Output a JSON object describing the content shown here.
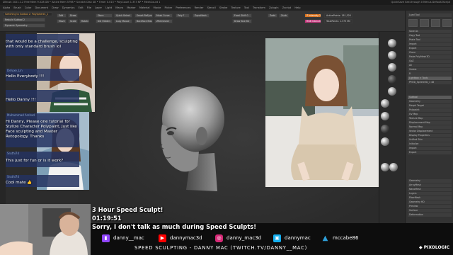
{
  "titlebar": {
    "text": "ZBrush 2021.1.2   Free Mem 9.028 GB • Active Mem 5798 • Scratch Disk 48 • Timer 0.013 • PolyCount 1.373 KP • MeshCount 1",
    "right": "QuickSave   See-through 0   Menus   DefaultZScript"
  },
  "menubar": {
    "items": [
      "Alpha",
      "Brush",
      "Color",
      "Document",
      "Draw",
      "Dynamics",
      "Edit",
      "File",
      "Layer",
      "Light",
      "Macro",
      "Marker",
      "Material",
      "Movie",
      "Picker",
      "Preferences",
      "Render",
      "Stencil",
      "Stroke",
      "Texture",
      "Tool",
      "Transform",
      "Zplugin",
      "Zscript",
      "Help"
    ]
  },
  "toolbar": {
    "switch_to": "Switching to Subtool 2: PolySphere1_1",
    "sub_left_1": "Rebuild Subtool 2",
    "sub_left_2": "Dynamic Symmetry",
    "edit": "Edit",
    "draw": "Draw",
    "move": "Move",
    "scale": "Scale",
    "rotate": "Rotate",
    "btn1": "Store",
    "btn2": "Quick Select",
    "btn3": "Smart ReSym",
    "btn4": "Mask Curve",
    "btn5": "Del Hidden",
    "btn6": "Lazy Mouse",
    "btn7": "Backface Mask",
    "btn8": "ZRemesher",
    "btn9": "Poly F",
    "dynamesh": "DynaMesh",
    "focal": "Focal Shift 0",
    "drawsize": "Draw Size 64",
    "zadd": "Zadd",
    "zsub": "Zsub",
    "zintensity": "Z Intensity 25",
    "rgbintensity": "RGB Intensity 100",
    "activepoints": "ActivePoints: 181,528",
    "totalpoints": "TotalPoints: 1.373 Mil"
  },
  "palette": {
    "rows": [
      "Load Tool",
      "Save As",
      "Copy Tool",
      "Paste Tool",
      "Import",
      "Export",
      "Clone",
      "Make PolyMesh3D",
      "GoZ",
      "All",
      "Visible",
      "R",
      "Lightbox > Tools",
      "PM3D_Sphere3D_1 48",
      "Subtool",
      "Geometry",
      "Morph Target",
      "Polypaint",
      "UV Map",
      "Texture Map",
      "Displacement Map",
      "Normal Map",
      "Vector Displacement",
      "Display Properties",
      "Unified Skin",
      "Initialize",
      "Import",
      "Export"
    ],
    "lower": [
      "Geometry",
      "ArrayMesh",
      "NanoMesh",
      "Layers",
      "FiberMesh",
      "Geometry HD",
      "Preview",
      "Surface",
      "Deformation"
    ]
  },
  "chat": {
    "messages": [
      {
        "name": "",
        "text": "that would be a challenge, sculpting with only standard brush lol"
      },
      {
        "name": "Deluxe_Lin",
        "text": "Hello Everybody !!!"
      },
      {
        "name": "",
        "text": "Hello Danny !!!"
      },
      {
        "name": "Muhammad Arshad",
        "text": "Hi Danny, Please one tutorial for Stylize Character Polypaint, Just like Face sculpting and Master Retopology. Thanks"
      },
      {
        "name": "Sruthi74",
        "text": "This just for fun or is it work?"
      },
      {
        "name": "Sruthi74",
        "text": "Cool mate 👍"
      }
    ]
  },
  "captions": {
    "title": "3 Hour Speed Sculpt!",
    "timer": "01:19:51",
    "note": "Sorry, I don't talk as much during Speed Sculpts!"
  },
  "socials": [
    {
      "platform": "twitch-icon",
      "handle": "danny__mac",
      "color": "#9146ff"
    },
    {
      "platform": "youtube-icon",
      "handle": "dannymac3d",
      "color": "#ff0000"
    },
    {
      "platform": "instagram-icon",
      "handle": "danny_mac3d",
      "color": "#d62976"
    },
    {
      "platform": "artstation-icon",
      "handle": "dannymac",
      "color": "#13aff0"
    },
    {
      "platform": "artstation-logo-icon",
      "handle": "mccabe86",
      "color": "#2e9fd8"
    }
  ],
  "footer": "SPEED SCULPTING - DANNY MAC (TWITCH.TV/DANNY__MAC)",
  "brand": "PIXOLOGIC",
  "colors": {
    "accent_orange": "#d8721e",
    "accent_pink": "#c2357a",
    "chat_bubble": "#253260"
  }
}
